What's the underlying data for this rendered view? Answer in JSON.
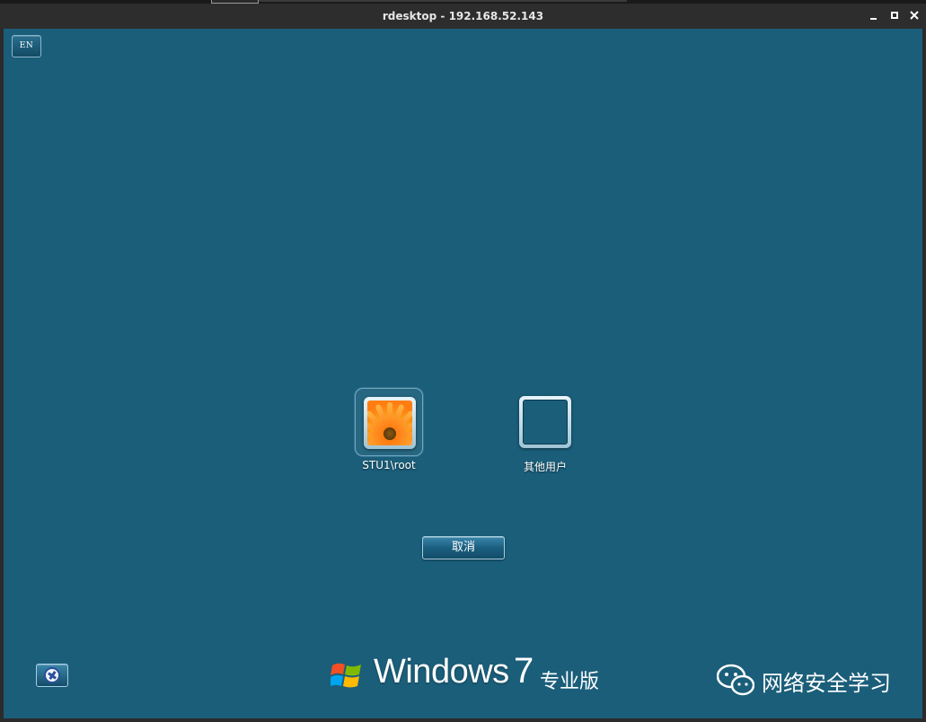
{
  "window": {
    "title": "rdesktop - 192.168.52.143",
    "controls": {
      "minimize": "minimize",
      "maximize": "maximize",
      "close": "close"
    }
  },
  "login_screen": {
    "language_indicator": "EN",
    "tiles": [
      {
        "label": "STU1\\root",
        "picture": "orange-flower-avatar",
        "selected": true
      },
      {
        "label": "其他用户",
        "picture": "blank-avatar",
        "selected": false
      }
    ],
    "cancel_label": "取消",
    "ease_of_access_icon": "ease-of-access-icon"
  },
  "branding": {
    "product": "Windows",
    "version": "7",
    "edition": "专业版",
    "colors": {
      "background": "#1a5e7a",
      "flag_red": "#f25022",
      "flag_green": "#7fba00",
      "flag_blue": "#00a4ef",
      "flag_yellow": "#ffb900"
    }
  },
  "watermark": {
    "icon": "wechat-icon",
    "text": "网络安全学习"
  }
}
